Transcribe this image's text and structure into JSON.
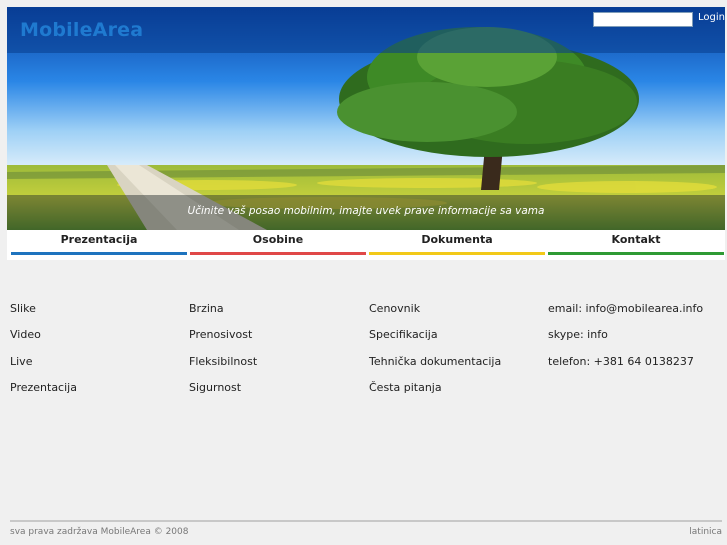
{
  "header": {
    "logo": "MobileArea",
    "login_label": "Login",
    "login_value": "",
    "tagline": "Učinite vaš posao mobilnim, imajte uvek prave informacije sa vama"
  },
  "nav": [
    {
      "label": "Prezentacija",
      "color": "#1e73be"
    },
    {
      "label": "Osobine",
      "color": "#e04848"
    },
    {
      "label": "Dokumenta",
      "color": "#f2c918"
    },
    {
      "label": "Kontakt",
      "color": "#2f9a34"
    }
  ],
  "columns": {
    "prezentacija": [
      "Slike",
      "Video",
      "Live",
      "Prezentacija"
    ],
    "osobine": [
      "Brzina",
      "Prenosivost",
      "Fleksibilnost",
      "Sigurnost"
    ],
    "dokumenta": [
      "Cenovnik",
      "Specifikacija",
      "Tehnička dokumentacija",
      "Česta pitanja"
    ],
    "kontakt": [
      "email: info@mobilearea.info",
      "skype: info",
      "telefon: +381 64 0138237"
    ]
  },
  "footer": {
    "copyright": "sva prava zadržava MobileArea © 2008",
    "language": "latinica"
  }
}
